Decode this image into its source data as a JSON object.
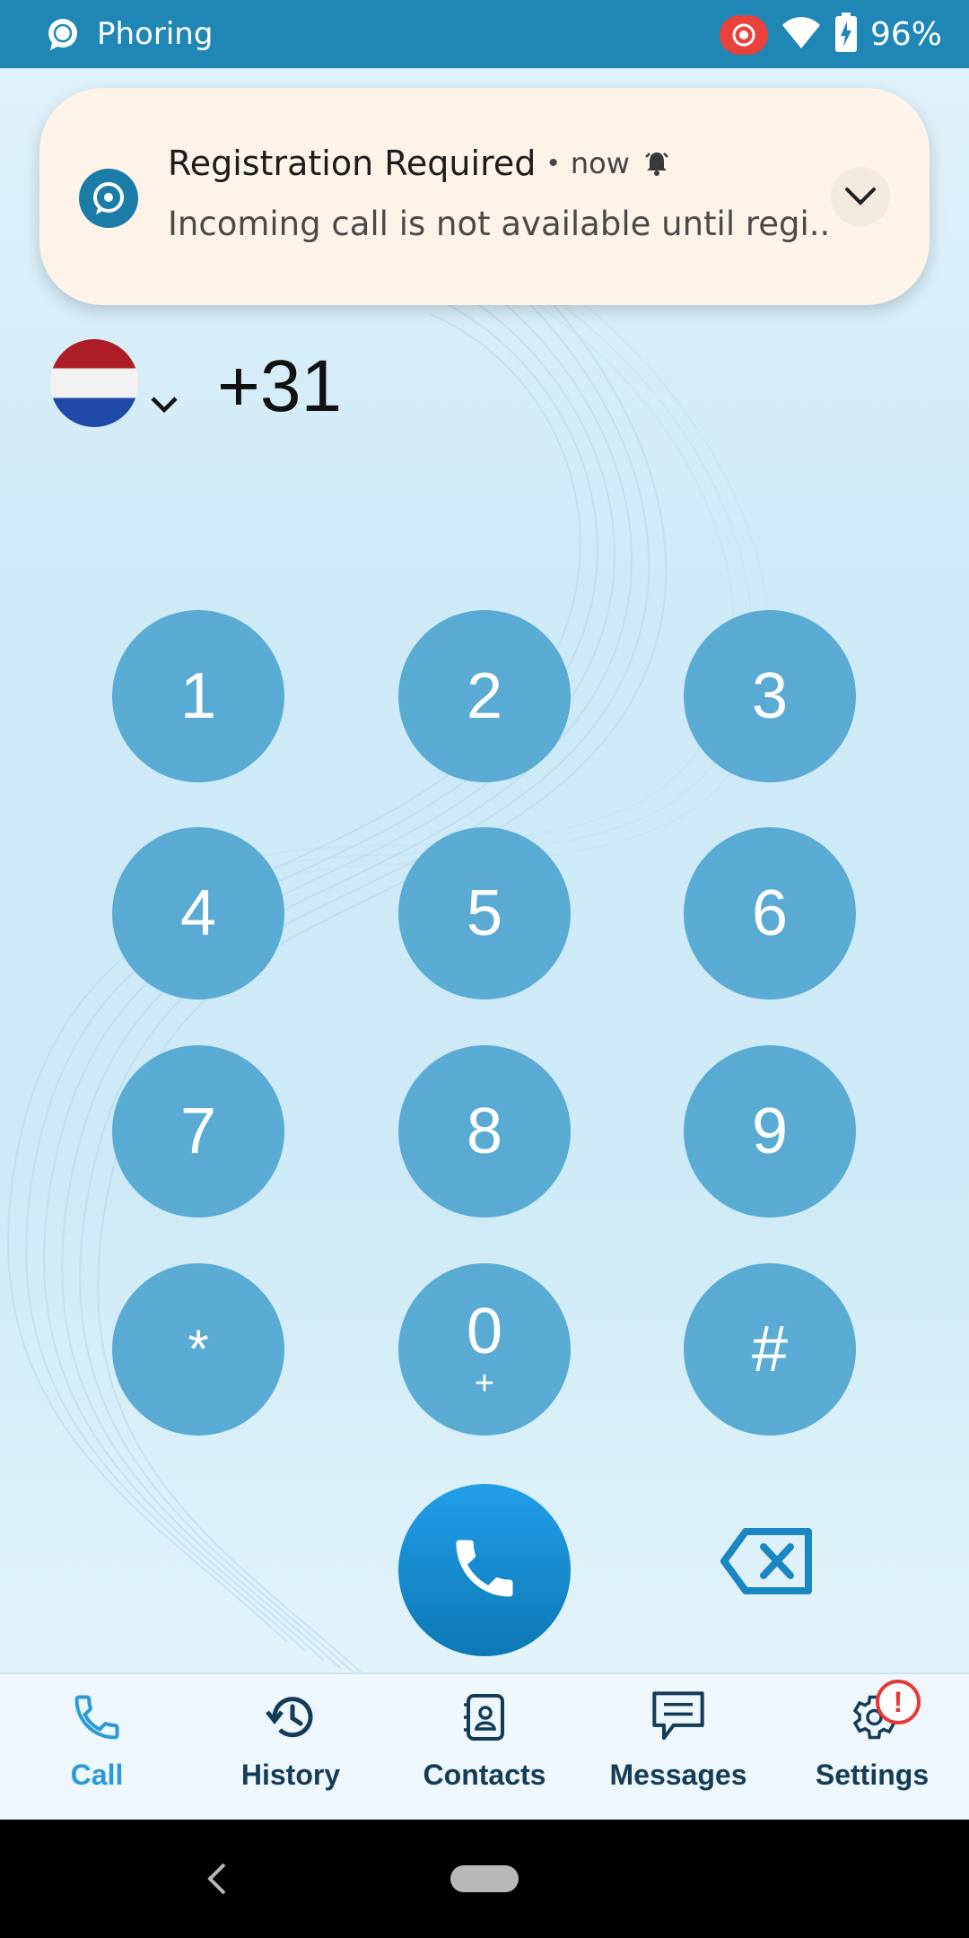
{
  "status_bar": {
    "app_name": "Phoring",
    "battery_percent": "96%",
    "icons": [
      "phoring-chat-icon",
      "screen-record-icon",
      "wifi-icon",
      "battery-charging-icon"
    ]
  },
  "notification": {
    "title": "Registration Required",
    "separator": "•",
    "time": "now",
    "body": "Incoming call is not available until regi..",
    "icons": [
      "phoring-app-icon",
      "alert-bell-icon",
      "expand-chevron-icon"
    ]
  },
  "dialer": {
    "country_flag": "netherlands-flag",
    "phone_number": "+31",
    "keys": [
      {
        "digit": "1",
        "sub": ""
      },
      {
        "digit": "2",
        "sub": ""
      },
      {
        "digit": "3",
        "sub": ""
      },
      {
        "digit": "4",
        "sub": ""
      },
      {
        "digit": "5",
        "sub": ""
      },
      {
        "digit": "6",
        "sub": ""
      },
      {
        "digit": "7",
        "sub": ""
      },
      {
        "digit": "8",
        "sub": ""
      },
      {
        "digit": "9",
        "sub": ""
      },
      {
        "digit": "*",
        "sub": ""
      },
      {
        "digit": "0",
        "sub": "+"
      },
      {
        "digit": "#",
        "sub": ""
      }
    ],
    "call_icon": "phone-icon",
    "backspace_icon": "backspace-icon"
  },
  "bottom_nav": {
    "items": [
      {
        "label": "Call",
        "icon": "phone-icon",
        "active": true
      },
      {
        "label": "History",
        "icon": "history-icon",
        "active": false
      },
      {
        "label": "Contacts",
        "icon": "contacts-icon",
        "active": false
      },
      {
        "label": "Messages",
        "icon": "messages-icon",
        "active": false
      },
      {
        "label": "Settings",
        "icon": "gear-icon",
        "active": false,
        "badge": "!"
      }
    ]
  },
  "colors": {
    "status_bar": "#1f86b6",
    "key": "#5aabd3",
    "call_button": "#1a8ccc",
    "nav_active": "#2b9ad6",
    "nav_inactive": "#143c57",
    "badge": "#e53935"
  }
}
